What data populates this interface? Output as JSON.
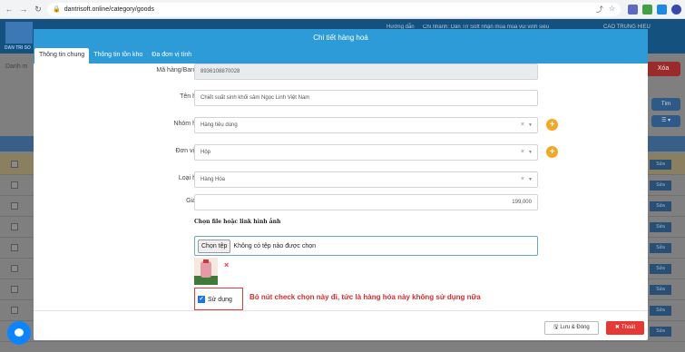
{
  "browser": {
    "url": "dantrisoft.online/category/goods",
    "back": "←",
    "forward": "→",
    "reload": "↻",
    "lock": "🔒"
  },
  "background": {
    "logo_text": "DAN TRI SO",
    "header_links": [
      "Hướng dẫn",
      "Chi nhánh: Dân Trí Soft nhận mùa mùa vui vinh siêu",
      "CAO TRUNG HIEU"
    ],
    "list_title": "Danh m",
    "delete_button": "Xóa",
    "search_button": "Tìm",
    "row_action": "Sửa"
  },
  "modal": {
    "title": "Chi tiết hàng hoá",
    "tabs": [
      {
        "label": "Thông tin chung",
        "active": true
      },
      {
        "label": "Thông tin tồn kho",
        "active": false
      },
      {
        "label": "Đa đơn vị tính",
        "active": false
      }
    ],
    "fields": {
      "barcode": {
        "label": "Mã hàng/Barcode",
        "required_mark": "(*)",
        "value": "8936108870028"
      },
      "name": {
        "label": "Tên hàng",
        "required_mark": "(*)",
        "value": "Chiết suất sinh khối sâm Ngọc Linh Việt Nam"
      },
      "group": {
        "label": "Nhóm hàng",
        "required_mark": "(*)",
        "value": "Hàng tiêu dùng",
        "clear": "×",
        "arrow": "▼"
      },
      "unit": {
        "label": "Đơn vị tính",
        "required_mark": "(*)",
        "value": "Hộp",
        "clear": "×",
        "arrow": "▼"
      },
      "type": {
        "label": "Loại hàng",
        "required_mark": "(*)",
        "value": "Hàng Hóa",
        "clear": "×",
        "arrow": "▼"
      },
      "price": {
        "label": "Giá bán lẻ",
        "value": "199,000"
      }
    },
    "plus_icon": "+",
    "file": {
      "title": "Chọn file hoặc link hình ảnh",
      "button": "Chọn tệp",
      "status": "Không có tệp nào được chọn",
      "remove": "×"
    },
    "active_check": {
      "label": "Sử dụng",
      "checked": true,
      "mark": "✔"
    },
    "note": "Bỏ nút check chọn này đi, tức là hàng hóa này không sử dụng nữa",
    "save_button": "Lưu & Đóng",
    "exit_button": "Thoát",
    "save_icon": "🖫",
    "exit_icon": "✖"
  },
  "colors": {
    "header": "#2d9bd8",
    "accent_orange": "#f5a623",
    "danger": "#e53935"
  }
}
